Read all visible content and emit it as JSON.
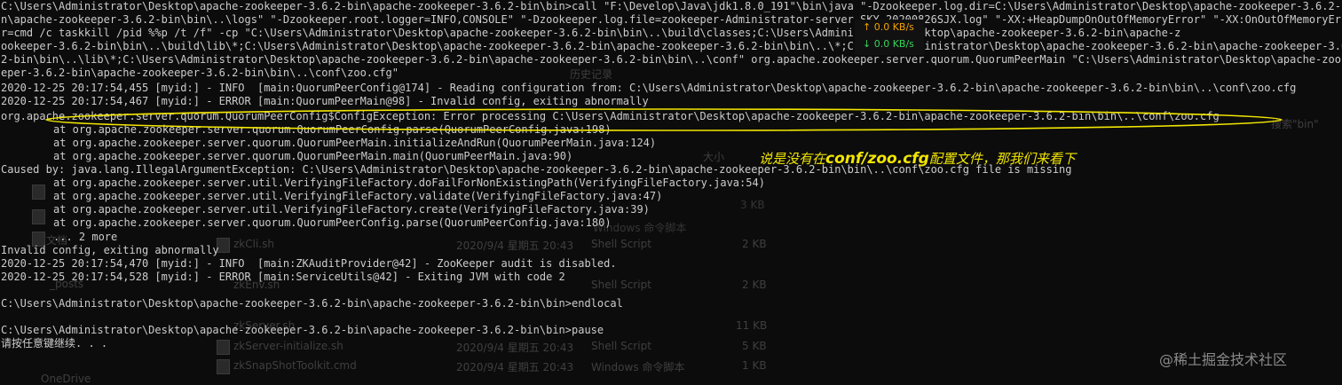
{
  "explorer": {
    "history_label": "历史记录",
    "search_label": "搜索\"bin\"",
    "column_size": "大小",
    "sidebar": [
      "文档",
      "_posts",
      "OneDrive"
    ],
    "files": [
      {
        "name": "zkCli.sh",
        "date": "2020/9/4 星期五 20:43",
        "type": "Shell Script",
        "size": "2 KB"
      },
      {
        "name": "zkEnv.sh",
        "date": "",
        "type": "Shell Script",
        "size": "2 KB"
      },
      {
        "name": "zkServer.sh",
        "date": "",
        "type": "",
        "size": "11 KB"
      },
      {
        "name": "zkServer-initialize.sh",
        "date": "2020/9/4 星期五 20:43",
        "type": "Shell Script",
        "size": "5 KB"
      },
      {
        "name": "zkSnapShotToolkit.cmd",
        "date": "2020/9/4 星期五 20:43",
        "type": "Windows 命令脚本",
        "size": "1 KB"
      }
    ],
    "faint_type_1": "Windows 命令脚本",
    "faint_size_top": "3 KB"
  },
  "console": {
    "lines": [
      {
        "text": "C:\\Users\\Administrator\\Desktop\\apache-zookeeper-3.6.2-bin\\apache-zookeeper-3.6.2-bin\\bin>call \"F:\\Develop\\Java\\jdk1.8.0_191\"\\bin\\java \"-Dzookeeper.log.dir=C:\\Users\\Administrator\\Desktop\\apache-zookeeper-3.6.2-bin\\apache-zookeeper-3.6.2-bi",
        "indent": false
      },
      {
        "text": "n\\apache-zookeeper-3.6.2-bin\\bin\\..\\logs\" \"-Dzookeeper.root.logger=INFO,CONSOLE\" \"-Dzookeeper.log.file=zookeeper-Administrator-server-SKY-20200826SJX.log\" \"-XX:+HeapDumpOnOutOfMemoryError\" \"-XX:OnOutOfMemoryErro",
        "indent": false
      },
      {
        "text": "r=cmd /c taskkill /pid %%p /t /f\" -cp \"C:\\Users\\Administrator\\Desktop\\apache-zookeeper-3.6.2-bin\\bin\\..\\build\\classes;C:\\Users\\Administrator\\Desktop\\apache-zookeeper-3.6.2-bin\\apache-z",
        "indent": false
      },
      {
        "text": "ookeeper-3.6.2-bin\\bin\\..\\build\\lib\\*;C:\\Users\\Administrator\\Desktop\\apache-zookeeper-3.6.2-bin\\apache-zookeeper-3.6.2-bin\\bin\\..\\*;C:\\Users\\Administrator\\Desktop\\apache-zookeeper-3.6.2-bin\\apache-zookeeper-3.6.",
        "indent": false
      },
      {
        "text": "2-bin\\bin\\..\\lib\\*;C:\\Users\\Administrator\\Desktop\\apache-zookeeper-3.6.2-bin\\apache-zookeeper-3.6.2-bin\\bin\\..\\conf\" org.apache.zookeeper.server.quorum.QuorumPeerMain \"C:\\Users\\Administrator\\Desktop\\apache-zook",
        "indent": false
      },
      {
        "text": "eper-3.6.2-bin\\apache-zookeeper-3.6.2-bin\\bin\\..\\conf\\zoo.cfg\"",
        "indent": false
      },
      {
        "text": "2020-12-25 20:17:54,455 [myid:] - INFO  [main:QuorumPeerConfig@174] - Reading configuration from: C:\\Users\\Administrator\\Desktop\\apache-zookeeper-3.6.2-bin\\apache-zookeeper-3.6.2-bin\\bin\\..\\conf\\zoo.cfg",
        "indent": false
      },
      {
        "text": "2020-12-25 20:17:54,467 [myid:] - ERROR [main:QuorumPeerMain@98] - Invalid config, exiting abnormally",
        "indent": false
      },
      {
        "text": "org.apache.zookeeper.server.quorum.QuorumPeerConfig$ConfigException: Error processing C:\\Users\\Administrator\\Desktop\\apache-zookeeper-3.6.2-bin\\apache-zookeeper-3.6.2-bin\\bin\\..\\conf\\zoo.cfg",
        "indent": false
      },
      {
        "text": "at org.apache.zookeeper.server.quorum.QuorumPeerConfig.parse(QuorumPeerConfig.java:198)",
        "indent": true
      },
      {
        "text": "at org.apache.zookeeper.server.quorum.QuorumPeerMain.initializeAndRun(QuorumPeerMain.java:124)",
        "indent": true
      },
      {
        "text": "at org.apache.zookeeper.server.quorum.QuorumPeerMain.main(QuorumPeerMain.java:90)",
        "indent": true
      },
      {
        "text": "Caused by: java.lang.IllegalArgumentException: C:\\Users\\Administrator\\Desktop\\apache-zookeeper-3.6.2-bin\\apache-zookeeper-3.6.2-bin\\bin\\..\\conf\\zoo.cfg file is missing",
        "indent": false
      },
      {
        "text": "at org.apache.zookeeper.server.util.VerifyingFileFactory.doFailForNonExistingPath(VerifyingFileFactory.java:54)",
        "indent": true
      },
      {
        "text": "at org.apache.zookeeper.server.util.VerifyingFileFactory.validate(VerifyingFileFactory.java:47)",
        "indent": true
      },
      {
        "text": "at org.apache.zookeeper.server.util.VerifyingFileFactory.create(VerifyingFileFactory.java:39)",
        "indent": true
      },
      {
        "text": "at org.apache.zookeeper.server.quorum.QuorumPeerConfig.parse(QuorumPeerConfig.java:180)",
        "indent": true
      },
      {
        "text": "... 2 more",
        "indent": true
      },
      {
        "text": "Invalid config, exiting abnormally",
        "indent": false
      },
      {
        "text": "2020-12-25 20:17:54,470 [myid:] - INFO  [main:ZKAuditProvider@42] - ZooKeeper audit is disabled.",
        "indent": false
      },
      {
        "text": "2020-12-25 20:17:54,528 [myid:] - ERROR [main:ServiceUtils@42] - Exiting JVM with code 2",
        "indent": false
      },
      {
        "text": "",
        "indent": false
      },
      {
        "text": "C:\\Users\\Administrator\\Desktop\\apache-zookeeper-3.6.2-bin\\apache-zookeeper-3.6.2-bin\\bin>endlocal",
        "indent": false
      },
      {
        "text": "",
        "indent": false
      },
      {
        "text": "C:\\Users\\Administrator\\Desktop\\apache-zookeeper-3.6.2-bin\\apache-zookeeper-3.6.2-bin\\bin>pause",
        "indent": false
      },
      {
        "text": "请按任意键继续. . .",
        "indent": false
      }
    ]
  },
  "net_speed": {
    "up": "↑ 0.0 KB/s",
    "down": "↓ 0.0 KB/s"
  },
  "annotation": {
    "prefix": "说是没有在",
    "highlight": "conf/zoo.cfg",
    "suffix": "配置文件，那我们来看下"
  },
  "watermark": "@稀土掘金技术社区",
  "colors": {
    "console_bg": "#0c0c0c",
    "console_text": "#cccccc",
    "annotation": "#f2e600",
    "net_up": "#f2a200",
    "net_down": "#36d45c",
    "ellipse": "#f2e600"
  }
}
